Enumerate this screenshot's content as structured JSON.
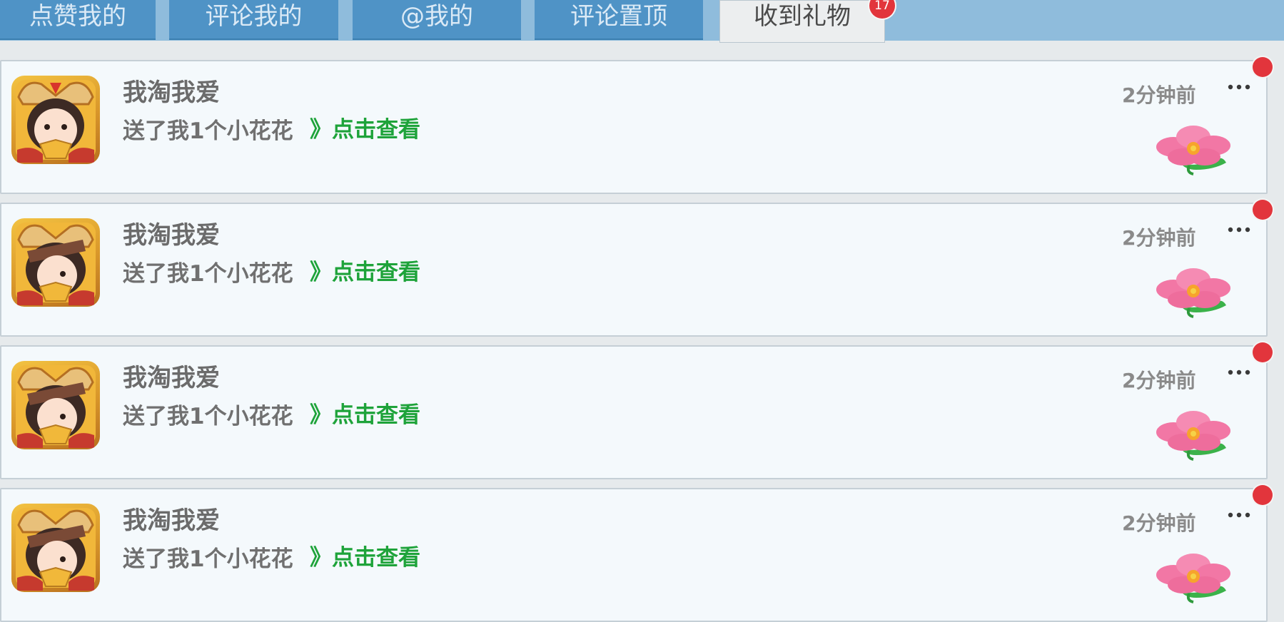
{
  "tabs": [
    {
      "label": "点赞我的",
      "active": false
    },
    {
      "label": "评论我的",
      "active": false
    },
    {
      "label": "@我的",
      "active": false
    },
    {
      "label": "评论置顶",
      "active": false
    },
    {
      "label": "收到礼物",
      "active": true,
      "badge": "17"
    }
  ],
  "notifications": [
    {
      "name": "我淘我爱",
      "message": "送了我1个小花花",
      "link": "》点击查看",
      "time": "2分钟前",
      "gift": "flower-icon",
      "unread": true
    },
    {
      "name": "我淘我爱",
      "message": "送了我1个小花花",
      "link": "》点击查看",
      "time": "2分钟前",
      "gift": "flower-icon",
      "unread": true
    },
    {
      "name": "我淘我爱",
      "message": "送了我1个小花花",
      "link": "》点击查看",
      "time": "2分钟前",
      "gift": "flower-icon",
      "unread": true
    },
    {
      "name": "我淘我爱",
      "message": "送了我1个小花花",
      "link": "》点击查看",
      "time": "2分钟前",
      "gift": "flower-icon",
      "unread": true
    }
  ],
  "colors": {
    "tab_bg": "#4f93c6",
    "tab_active_bg": "#eceeef",
    "link_green": "#1ea33a",
    "badge_red": "#e2353c"
  }
}
